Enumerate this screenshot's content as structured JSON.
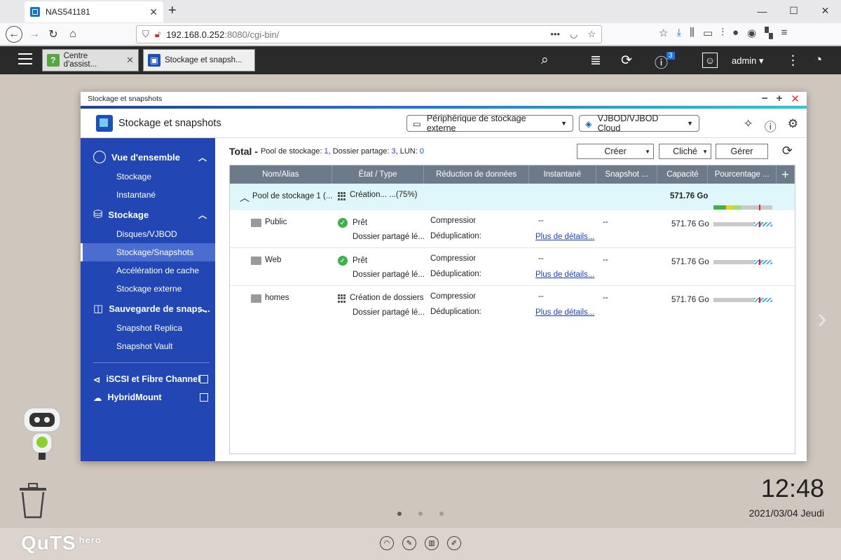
{
  "browser": {
    "tab_title": "NAS541181",
    "tab_close": "✕",
    "new_tab": "+",
    "url_host": "192.168.0.252",
    "url_path": ":8080/cgi-bin/",
    "url_more": "•••"
  },
  "nas": {
    "tabs": [
      {
        "label": "Centre d'assist...",
        "color": "#4caf50"
      },
      {
        "label": "Stockage et snapsh...",
        "color": "#1d4fb8"
      }
    ],
    "notif_count": "3",
    "user": "admin ▾"
  },
  "window": {
    "title": "Stockage et snapshots",
    "app_title": "Stockage et snapshots",
    "dropdown_external": "Périphérique de stockage externe",
    "dropdown_vjbod": "VJBOD/VJBOD Cloud"
  },
  "sidebar": {
    "overview": "Vue d'ensemble",
    "overview_items": [
      "Stockage",
      "Instantané"
    ],
    "storage": "Stockage",
    "storage_items": [
      "Disques/VJBOD",
      "Stockage/Snapshots",
      "Accélération de cache",
      "Stockage externe"
    ],
    "backup": "Sauvegarde de snaps...",
    "backup_items": [
      "Snapshot Replica",
      "Snapshot Vault"
    ],
    "iscsi": "iSCSI et Fibre Channel",
    "hybrid": "HybridMount"
  },
  "summary": {
    "total": "Total -",
    "pool_label": "Pool de stockage:",
    "pool_count": "1",
    "share_label": ", Dossier partage:",
    "share_count": "3",
    "lun_label": ", LUN:",
    "lun_count": "0",
    "btn_create": "Créer",
    "btn_snapshot": "Cliché",
    "btn_manage": "Gérer"
  },
  "table": {
    "headers": [
      "Nom/Alias",
      "État / Type",
      "Réduction de données",
      "Instantané",
      "Snapshot ...",
      "Capacité",
      "Pourcentage ..."
    ],
    "pool": {
      "name": "Pool de stockage 1 (...",
      "status": "Création... ...(75%)",
      "capacity": "571.76 Go"
    },
    "shares": [
      {
        "name": "Public",
        "status": "Prêt",
        "type": "Dossier partagé lé...",
        "compression": "Compression:",
        "dedup": "Déduplication:",
        "snapshot": "--",
        "details": "Plus de détails...",
        "snap2": "--",
        "capacity": "571.76 Go",
        "status_icon": "check"
      },
      {
        "name": "Web",
        "status": "Prêt",
        "type": "Dossier partagé lé...",
        "compression": "Compression:",
        "dedup": "Déduplication:",
        "snapshot": "--",
        "details": "Plus de détails...",
        "snap2": "--",
        "capacity": "571.76 Go",
        "status_icon": "check"
      },
      {
        "name": "homes",
        "status": "Création de dossiers",
        "type": "Dossier partagé lé...",
        "compression": "Compression:",
        "dedup": "Déduplication:",
        "snapshot": "--",
        "details": "Plus de détails...",
        "snap2": "--",
        "capacity": "571.76 Go",
        "status_icon": "grid"
      }
    ]
  },
  "desktop": {
    "time": "12:48",
    "date": "2021/03/04 Jeudi",
    "logo": "QuTS",
    "logo_sup": "hero"
  }
}
